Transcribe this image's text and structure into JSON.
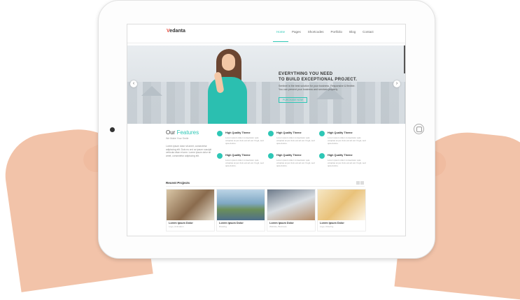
{
  "site": {
    "logo_accent": "V",
    "logo_rest": "edanta",
    "nav": [
      "Home",
      "Pages",
      "Shortcodes",
      "Portfolio",
      "Blog",
      "Contact"
    ],
    "active_nav": "Home"
  },
  "hero": {
    "title_line1": "EVERYTHING YOU NEED",
    "title_line2": "TO BUILD EXCEPTIONAL PROJECT.",
    "text": "Sentinel is the best solution for your business. Responsive & flexible. You can present your business and services properly.",
    "button": "PURCHASE NOW",
    "prev": "‹",
    "next": "›"
  },
  "features": {
    "heading_plain": "Our ",
    "heading_accent": "Features",
    "subheading": "We Make Your Smile",
    "description": "Lorem ipsum dolor sit amet, consectetur adipiscing elit. Duis eu orci ac ipsum suscipit vehicula vitae et sem. Lorem ipsum dolor sit amet, consectetur adipiscing elit.",
    "items": [
      {
        "title": "High Quality Theme",
        "text": "Lorem ipsum dolor consectetur quis voluptas at per duis est ad est. Fugit, sed quia dolore."
      },
      {
        "title": "High Quality Theme",
        "text": "Lorem ipsum dolor consectetur quis voluptas at per duis est ad est. Fugit, sed quia dolore."
      },
      {
        "title": "High Quality Theme",
        "text": "Lorem ipsum dolor consectetur quis voluptas at per duis est ad est. Fugit, sed quia dolore."
      },
      {
        "title": "High Quality Theme",
        "text": "Lorem ipsum dolor consectetur quis voluptas at per duis est ad est. Fugit, sed quia dolore."
      },
      {
        "title": "High Quality Theme",
        "text": "Lorem ipsum dolor consectetur quis voluptas at per duis est ad est. Fugit, sed quia dolore."
      },
      {
        "title": "High Quality Theme",
        "text": "Lorem ipsum dolor consectetur quis voluptas at per duis est ad est. Fugit, sed quia dolore."
      }
    ]
  },
  "projects": {
    "heading": "Recent Projects",
    "items": [
      {
        "title": "Lorem Ipsum Dolor",
        "category": "Logo, Animation"
      },
      {
        "title": "Lorem Ipsum Dolor",
        "category": "Drawing"
      },
      {
        "title": "Lorem Ipsum Dolor",
        "category": "Website, Business"
      },
      {
        "title": "Lorem Ipsum Dolor",
        "category": "Logo, Drawing"
      }
    ]
  },
  "colors": {
    "accent": "#2ec7b6",
    "logo_accent": "#e64a3c"
  }
}
